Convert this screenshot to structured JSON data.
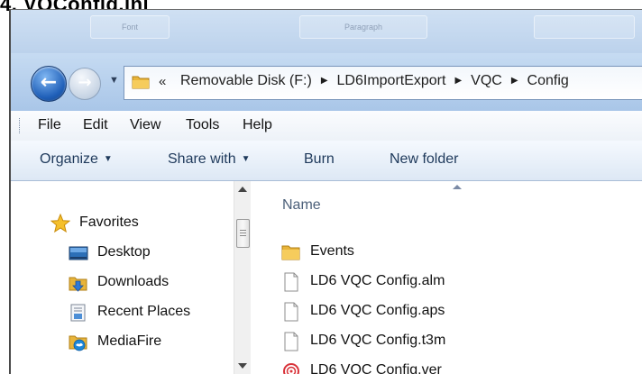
{
  "heading": "4.  VQConfig.ini",
  "window": {
    "title_ghosts": [
      "Font",
      "Paragraph"
    ]
  },
  "navigation": {
    "back_glyph": "←",
    "forward_glyph": "→",
    "history_dropdown": "▼",
    "chevron": "«",
    "separator": "▶",
    "breadcrumbs": [
      "Removable Disk (F:)",
      "LD6ImportExport",
      "VQC",
      "Config"
    ]
  },
  "menu": {
    "items": [
      "File",
      "Edit",
      "View",
      "Tools",
      "Help"
    ]
  },
  "toolbar": {
    "organize": "Organize",
    "share_with": "Share with",
    "burn": "Burn",
    "new_folder": "New folder",
    "dropdown_arrow": "▼"
  },
  "nav_pane": {
    "items": [
      {
        "label": "Favorites",
        "icon": "star-icon"
      },
      {
        "label": "Desktop",
        "icon": "desktop-icon"
      },
      {
        "label": "Downloads",
        "icon": "downloads-icon"
      },
      {
        "label": "Recent Places",
        "icon": "recent-places-icon"
      },
      {
        "label": "MediaFire",
        "icon": "mediafire-icon"
      }
    ]
  },
  "file_list": {
    "column_header": "Name",
    "items": [
      {
        "name": "Events",
        "icon": "folder-icon"
      },
      {
        "name": "LD6 VQC Config.alm",
        "icon": "document-icon"
      },
      {
        "name": "LD6 VQC Config.aps",
        "icon": "document-icon"
      },
      {
        "name": "LD6 VQC Config.t3m",
        "icon": "document-icon"
      },
      {
        "name": "LD6 VQC Config.ver",
        "icon": "ver-file-icon"
      }
    ]
  },
  "colors": {
    "accent": "#1f5fb8",
    "toolbar_text": "#1e395b",
    "header_text": "#4c607a",
    "folder": "#e8b43a"
  }
}
